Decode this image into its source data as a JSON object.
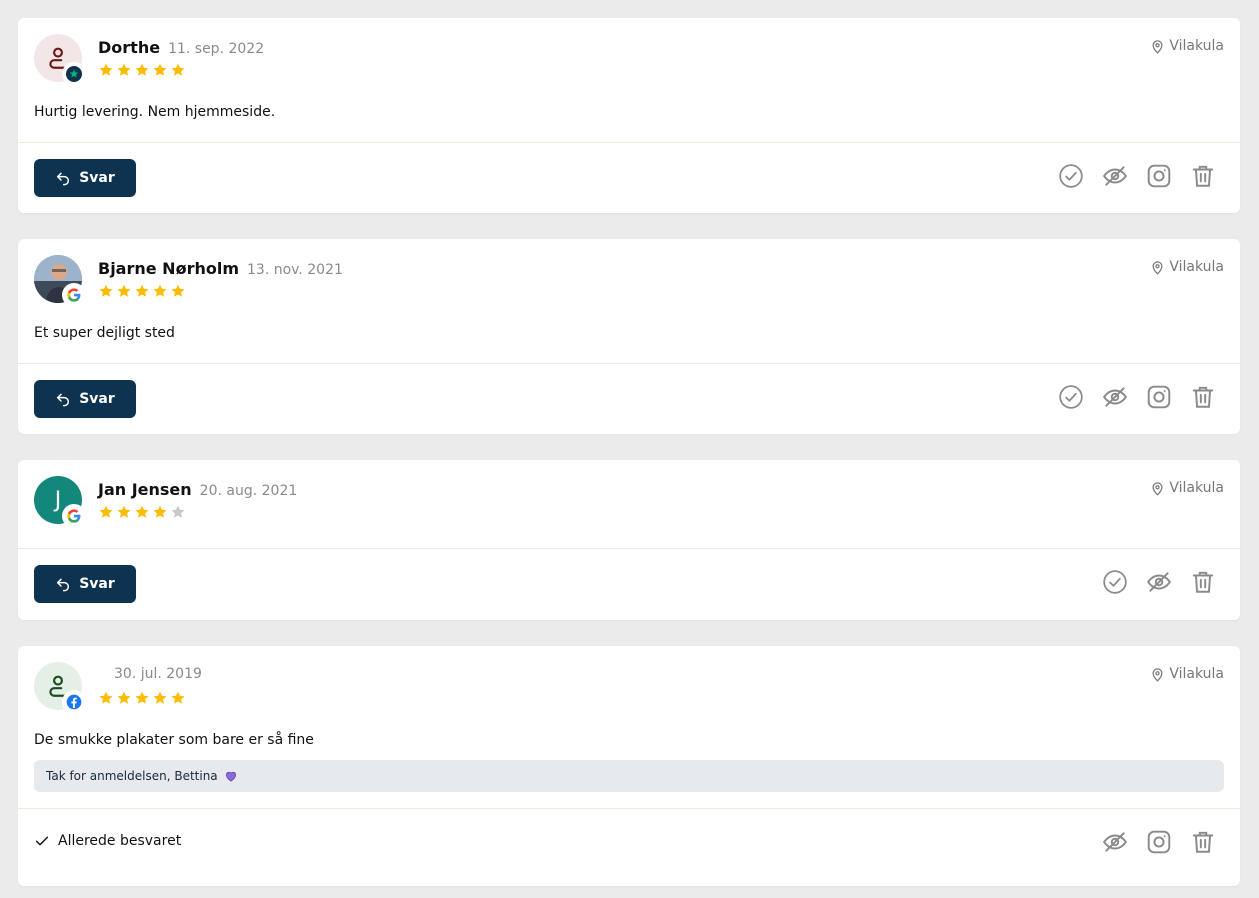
{
  "colors": {
    "page_bg": "#ebebeb",
    "card_bg": "#ffffff",
    "button_bg": "#0d3350",
    "star_filled": "#fbbc05",
    "star_empty": "#c8c8c8",
    "icon_gray": "#8a8a8a",
    "reply_bg": "#e6e9ed"
  },
  "actions_labels": {
    "reply": "Svar",
    "already_answered": "Allerede besvaret"
  },
  "reviews": [
    {
      "name": "Dorthe",
      "date": "11. sep. 2022",
      "rating": 5,
      "source": "trustpilot-badge-icon",
      "avatar": "person-icon",
      "location": "Vilakula",
      "text": "Hurtig levering. Nem hjemmeside."
    },
    {
      "name": "Bjarne Nørholm",
      "date": "13. nov. 2021",
      "rating": 5,
      "source": "google-badge-icon",
      "avatar": "photo",
      "location": "Vilakula",
      "text": "Et super dejligt sted"
    },
    {
      "name": "Jan Jensen",
      "date": "20. aug. 2021",
      "rating": 4,
      "source": "google-badge-icon",
      "avatar": "initial",
      "avatar_initial": "J",
      "location": "Vilakula",
      "text": ""
    },
    {
      "name": "",
      "date": "30. jul. 2019",
      "rating": 5,
      "source": "facebook-badge-icon",
      "avatar": "person-icon",
      "location": "Vilakula",
      "text": "De smukke plakater som bare er så fine",
      "reply": "Tak for anmeldelsen, Bettina"
    }
  ]
}
